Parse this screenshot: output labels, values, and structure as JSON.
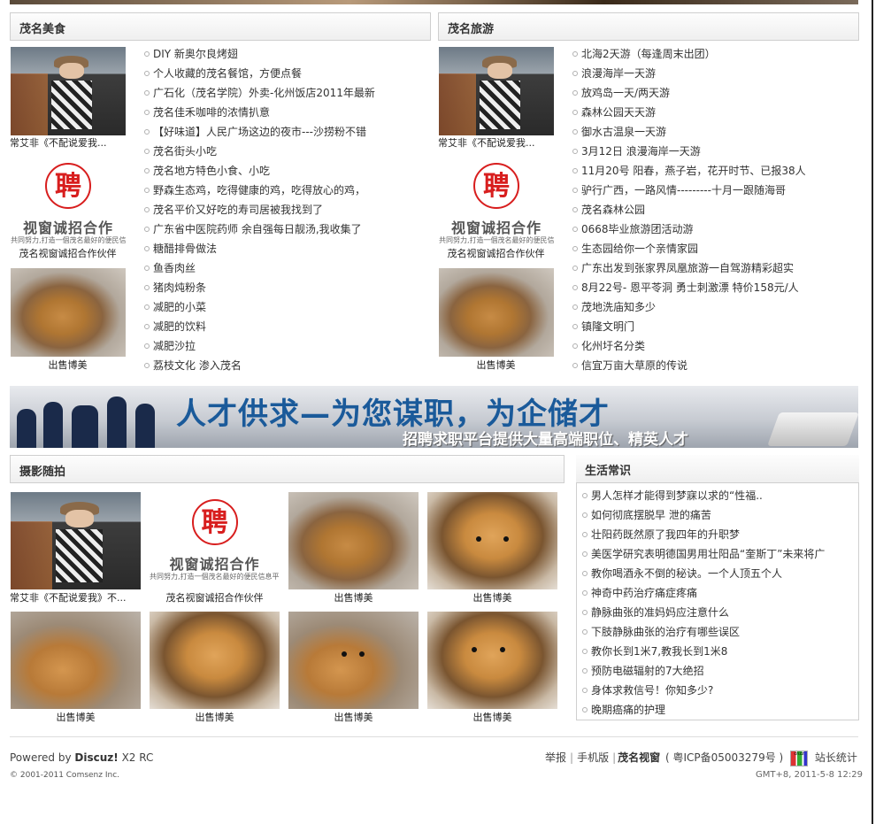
{
  "food": {
    "title": "茂名美食",
    "thumbs": [
      {
        "caption": "常艾非《不配说爱我..."
      },
      {
        "caption": "茂名视窗诚招合作伙伴",
        "seal": "聘",
        "slogan": "视窗诚招合作",
        "tagline": "共同努力,打造一個茂名最好的便民信息平臺!"
      },
      {
        "caption": "出售博美"
      }
    ],
    "items": [
      "DIY 新奥尔良烤翅",
      "个人收藏的茂名餐馆，方便点餐",
      "广石化（茂名学院）外卖-化州饭店2011年最新",
      "茂名佳禾咖啡的浓情扒意",
      "【好味道】人民广场这边的夜市---沙捞粉不错",
      "茂名街头小吃",
      "茂名地方特色小食、小吃",
      "野森生态鸡，吃得健康的鸡，吃得放心的鸡，",
      "茂名平价又好吃的寿司居被我找到了",
      "广东省中医院药师 余自强每日靓汤,我收集了",
      "糖醋排骨做法",
      "鱼香肉丝",
      "猪肉炖粉条",
      "减肥的小菜",
      "减肥的饮料",
      "减肥沙拉",
      "荔枝文化 渗入茂名"
    ]
  },
  "travel": {
    "title": "茂名旅游",
    "thumbs": [
      {
        "caption": "常艾非《不配说爱我..."
      },
      {
        "caption": "茂名视窗诚招合作伙伴",
        "seal": "聘",
        "slogan": "视窗诚招合作",
        "tagline": "共同努力,打造一個茂名最好的便民信息平臺!"
      },
      {
        "caption": "出售博美"
      }
    ],
    "items": [
      "北海2天游（每逢周末出团）",
      "浪漫海岸一天游",
      "放鸡岛一天/两天游",
      "森林公园天天游",
      "御水古温泉一天游",
      "3月12日 浪漫海岸一天游",
      "11月20号 阳春，燕子岩，花开时节、已报38人",
      "驴行广西，一路风情---------十月一跟随海哥",
      "茂名森林公园",
      "0668毕业旅游团活动游",
      "生态园给你一个亲情家园",
      "广东出发到张家界凤凰旅游一自驾游精彩超实",
      "8月22号- 恩平苓洞 勇士刺激漂 特价158元/人",
      "茂地洗庙知多少",
      "镇隆文明门",
      "化州圩名分类",
      "信宜万亩大草原的传说"
    ]
  },
  "banner": {
    "headline": "人才供求—为您谋职，为企储才",
    "subline": "招聘求职平台提供大量高端职位、精英人才"
  },
  "photo": {
    "title": "摄影随拍",
    "items": [
      {
        "caption": "常艾非《不配说爱我》不..."
      },
      {
        "caption": "茂名视窗诚招合作伙伴",
        "seal": "聘",
        "slogan": "视窗诚招合作",
        "tagline": "共同努力,打造一個茂名最好的便民信息平臺!"
      },
      {
        "caption": "出售博美"
      },
      {
        "caption": "出售博美"
      },
      {
        "caption": "出售博美"
      },
      {
        "caption": "出售博美"
      },
      {
        "caption": "出售博美"
      },
      {
        "caption": "出售博美"
      }
    ]
  },
  "life": {
    "title": "生活常识",
    "items": [
      "男人怎样才能得到梦寐以求的“性福..",
      "如何彻底摆脱早 泄的痛苦",
      "壮阳药既然原了我四年的升职梦",
      "美医学研究表明德国男用壮阳品“奎斯丁”未来将广",
      "教你喝酒永不倒的秘诀。一个人顶五个人",
      "神奇中药治疗痛症疼痛",
      "静脉曲张的准妈妈应注意什么",
      "下肢静脉曲张的治疗有哪些误区",
      "教你长到1米7,教我长到1米8",
      "预防电磁辐射的7大绝招",
      "身体求救信号！你知多少?",
      "晚期癌痛的护理"
    ]
  },
  "footer": {
    "powered_prefix": "Powered by",
    "powered_brand": "Discuz!",
    "powered_version": "X2 RC",
    "copyright": "© 2001-2011 Comsenz Inc.",
    "links": {
      "report": "举报",
      "mobile": "手机版",
      "site": "茂名视窗",
      "icp": "( 粤ICP备05003279号 )",
      "stats_icon_label": "cnzz",
      "stats": "站长统计"
    },
    "time": "GMT+8, 2011-5-8 12:29"
  }
}
